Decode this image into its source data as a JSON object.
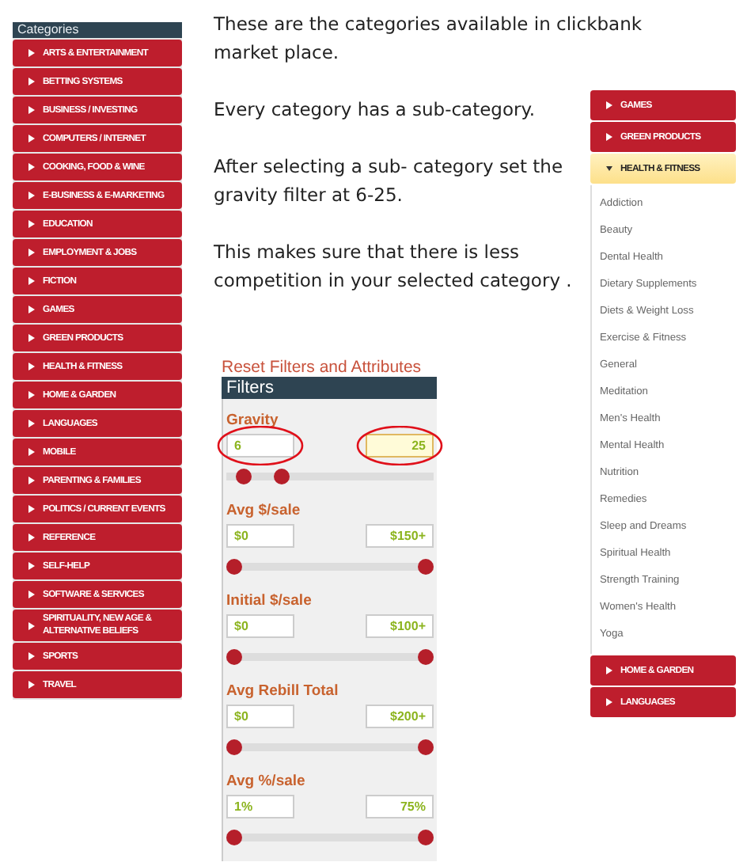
{
  "sidebar": {
    "title": "Categories",
    "items": [
      {
        "label": "ARTS & ENTERTAINMENT"
      },
      {
        "label": "BETTING SYSTEMS"
      },
      {
        "label": "BUSINESS / INVESTING"
      },
      {
        "label": "COMPUTERS / INTERNET"
      },
      {
        "label": "COOKING, FOOD & WINE"
      },
      {
        "label": "E-BUSINESS & E-MARKETING"
      },
      {
        "label": "EDUCATION"
      },
      {
        "label": "EMPLOYMENT & JOBS"
      },
      {
        "label": "FICTION"
      },
      {
        "label": "GAMES"
      },
      {
        "label": "GREEN PRODUCTS"
      },
      {
        "label": "HEALTH & FITNESS"
      },
      {
        "label": "HOME & GARDEN"
      },
      {
        "label": "LANGUAGES"
      },
      {
        "label": "MOBILE"
      },
      {
        "label": "PARENTING & FAMILIES"
      },
      {
        "label": "POLITICS / CURRENT EVENTS"
      },
      {
        "label": "REFERENCE"
      },
      {
        "label": "SELF-HELP"
      },
      {
        "label": "SOFTWARE & SERVICES"
      },
      {
        "label": "SPIRITUALITY, NEW AGE & ALTERNATIVE BELIEFS"
      },
      {
        "label": "SPORTS"
      },
      {
        "label": "TRAVEL"
      }
    ]
  },
  "paragraphs": [
    "These are the categories available in clickbank market place.",
    "Every category has a sub-category.",
    "After selecting a sub- category set the gravity filter at 6-25.",
    "This makes sure that there is less competition in your selected category ."
  ],
  "filters": {
    "reset_link": "Reset Filters and Attributes",
    "title": "Filters",
    "groups": [
      {
        "label": "Gravity",
        "min": {
          "value": "6",
          "focused": false,
          "circled": true
        },
        "max": {
          "value": "25",
          "focused": true,
          "circled": true
        },
        "thumbs": [
          {
            "level": 0.05
          },
          {
            "level": 0.25
          }
        ]
      },
      {
        "label": "Avg $/sale",
        "min": {
          "value": "$0",
          "focused": false,
          "circled": false
        },
        "max": {
          "value": "$150+",
          "focused": false,
          "circled": false
        },
        "thumbs": [
          {
            "level": 0
          },
          {
            "level": 1
          }
        ]
      },
      {
        "label": "Initial $/sale",
        "min": {
          "value": "$0",
          "focused": false,
          "circled": false
        },
        "max": {
          "value": "$100+",
          "focused": false,
          "circled": false
        },
        "thumbs": [
          {
            "level": 0
          },
          {
            "level": 1
          }
        ]
      },
      {
        "label": "Avg Rebill Total",
        "min": {
          "value": "$0",
          "focused": false,
          "circled": false
        },
        "max": {
          "value": "$200+",
          "focused": false,
          "circled": false
        },
        "thumbs": [
          {
            "level": 0
          },
          {
            "level": 1
          }
        ]
      },
      {
        "label": "Avg %/sale",
        "min": {
          "value": "1%",
          "focused": false,
          "circled": false
        },
        "max": {
          "value": "75%",
          "focused": false,
          "circled": false
        },
        "thumbs": [
          {
            "level": 0
          },
          {
            "level": 1
          }
        ]
      }
    ]
  },
  "category_menu": {
    "items": [
      {
        "label": "GAMES",
        "expanded": false
      },
      {
        "label": "GREEN PRODUCTS",
        "expanded": false
      },
      {
        "label": "HEALTH & FITNESS",
        "expanded": true,
        "children": [
          {
            "label": "Addiction"
          },
          {
            "label": "Beauty"
          },
          {
            "label": "Dental Health"
          },
          {
            "label": "Dietary Supplements"
          },
          {
            "label": "Diets & Weight Loss"
          },
          {
            "label": "Exercise & Fitness"
          },
          {
            "label": "General"
          },
          {
            "label": "Meditation"
          },
          {
            "label": "Men's Health"
          },
          {
            "label": "Mental Health"
          },
          {
            "label": "Nutrition"
          },
          {
            "label": "Remedies"
          },
          {
            "label": "Sleep and Dreams"
          },
          {
            "label": "Spiritual Health"
          },
          {
            "label": "Strength Training"
          },
          {
            "label": "Women's Health"
          },
          {
            "label": "Yoga"
          }
        ]
      },
      {
        "label": "HOME & GARDEN",
        "expanded": false
      },
      {
        "label": "LANGUAGES",
        "expanded": false
      }
    ]
  }
}
